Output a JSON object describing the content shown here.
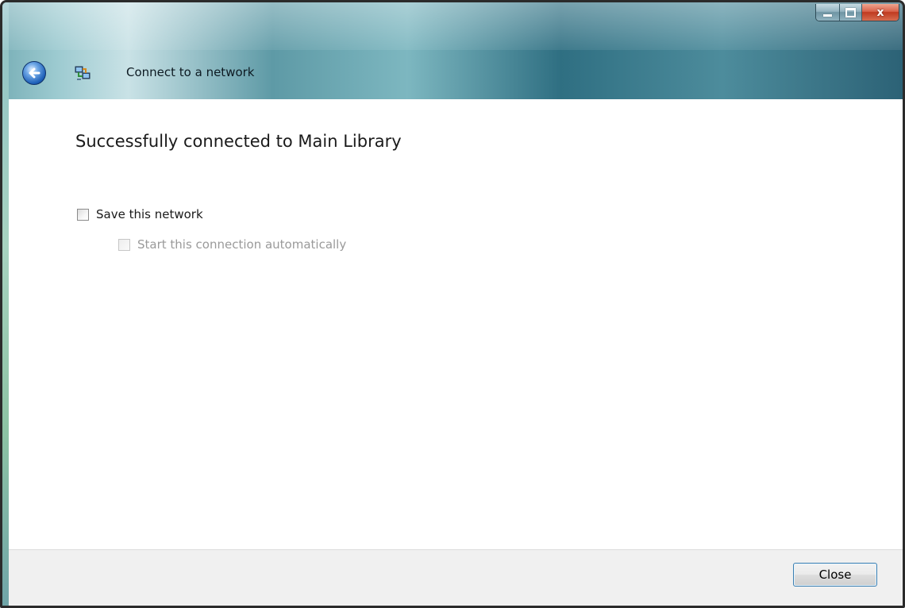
{
  "window": {
    "title": "Connect to a network",
    "controls": {
      "minimize": "minimize",
      "maximize": "maximize",
      "close_glyph": "x"
    },
    "accent_close": "#c03a1f",
    "title_gradient": [
      "#7ab0b8",
      "#2c6276"
    ]
  },
  "icons": {
    "back": "back-arrow-icon",
    "network": "network-connect-icon"
  },
  "content": {
    "heading": "Successfully connected to Main Library",
    "options": [
      {
        "label": "Save this network",
        "checked": false,
        "enabled": true
      },
      {
        "label": "Start this connection automatically",
        "checked": false,
        "enabled": false
      }
    ]
  },
  "footer": {
    "close_label": "Close"
  }
}
